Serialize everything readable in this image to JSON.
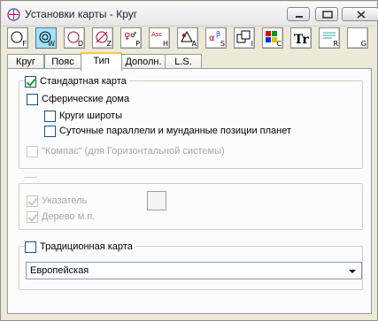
{
  "window": {
    "title": "Установки карты - Круг"
  },
  "toolbar": {
    "buttons": [
      {
        "icon": "circle-icon",
        "sub": "F",
        "active": false
      },
      {
        "icon": "circle-icon",
        "sub": "W",
        "active": true
      },
      {
        "icon": "circle-icon",
        "sub": "D",
        "active": false
      },
      {
        "icon": "circle-icon",
        "sub": "Z",
        "active": false
      },
      {
        "icon": "planet-glyphs-icon",
        "sub": "P",
        "active": false
      },
      {
        "icon": "ascendant-icon",
        "text": "Asc",
        "sub": "H",
        "active": false
      },
      {
        "icon": "triangle-icon",
        "sub": "A",
        "active": false
      },
      {
        "icon": "aspect-glyphs-icon",
        "sub": "S",
        "active": false
      },
      {
        "icon": "squares-icon",
        "sub": "I",
        "active": false
      },
      {
        "icon": "color-palette-icon",
        "sub": "C",
        "active": false
      },
      {
        "icon": "font-icon",
        "text": "Tr",
        "active": false
      },
      {
        "icon": "lines-icon",
        "sub": "R",
        "active": false
      },
      {
        "icon": "blank-icon",
        "sub": "G",
        "active": false
      }
    ]
  },
  "tabs": [
    "Круг",
    "Пояс",
    "Тип",
    "Дополн.",
    "L.S."
  ],
  "active_tab": "Тип",
  "type_tab": {
    "standard_chart": "Стандартная карта",
    "spherical_houses": "Сферические дома",
    "latitude_circles": "Круги широты",
    "daily_parallels": "Суточные параллели и мунданные позиции планет",
    "compass": "\"Компас\" (для Горизонтальной системы)",
    "pointer": "Указатель",
    "tree": "Дерево м.п.",
    "traditional_chart": "Традиционная карта",
    "style_select_value": "Европейская"
  }
}
